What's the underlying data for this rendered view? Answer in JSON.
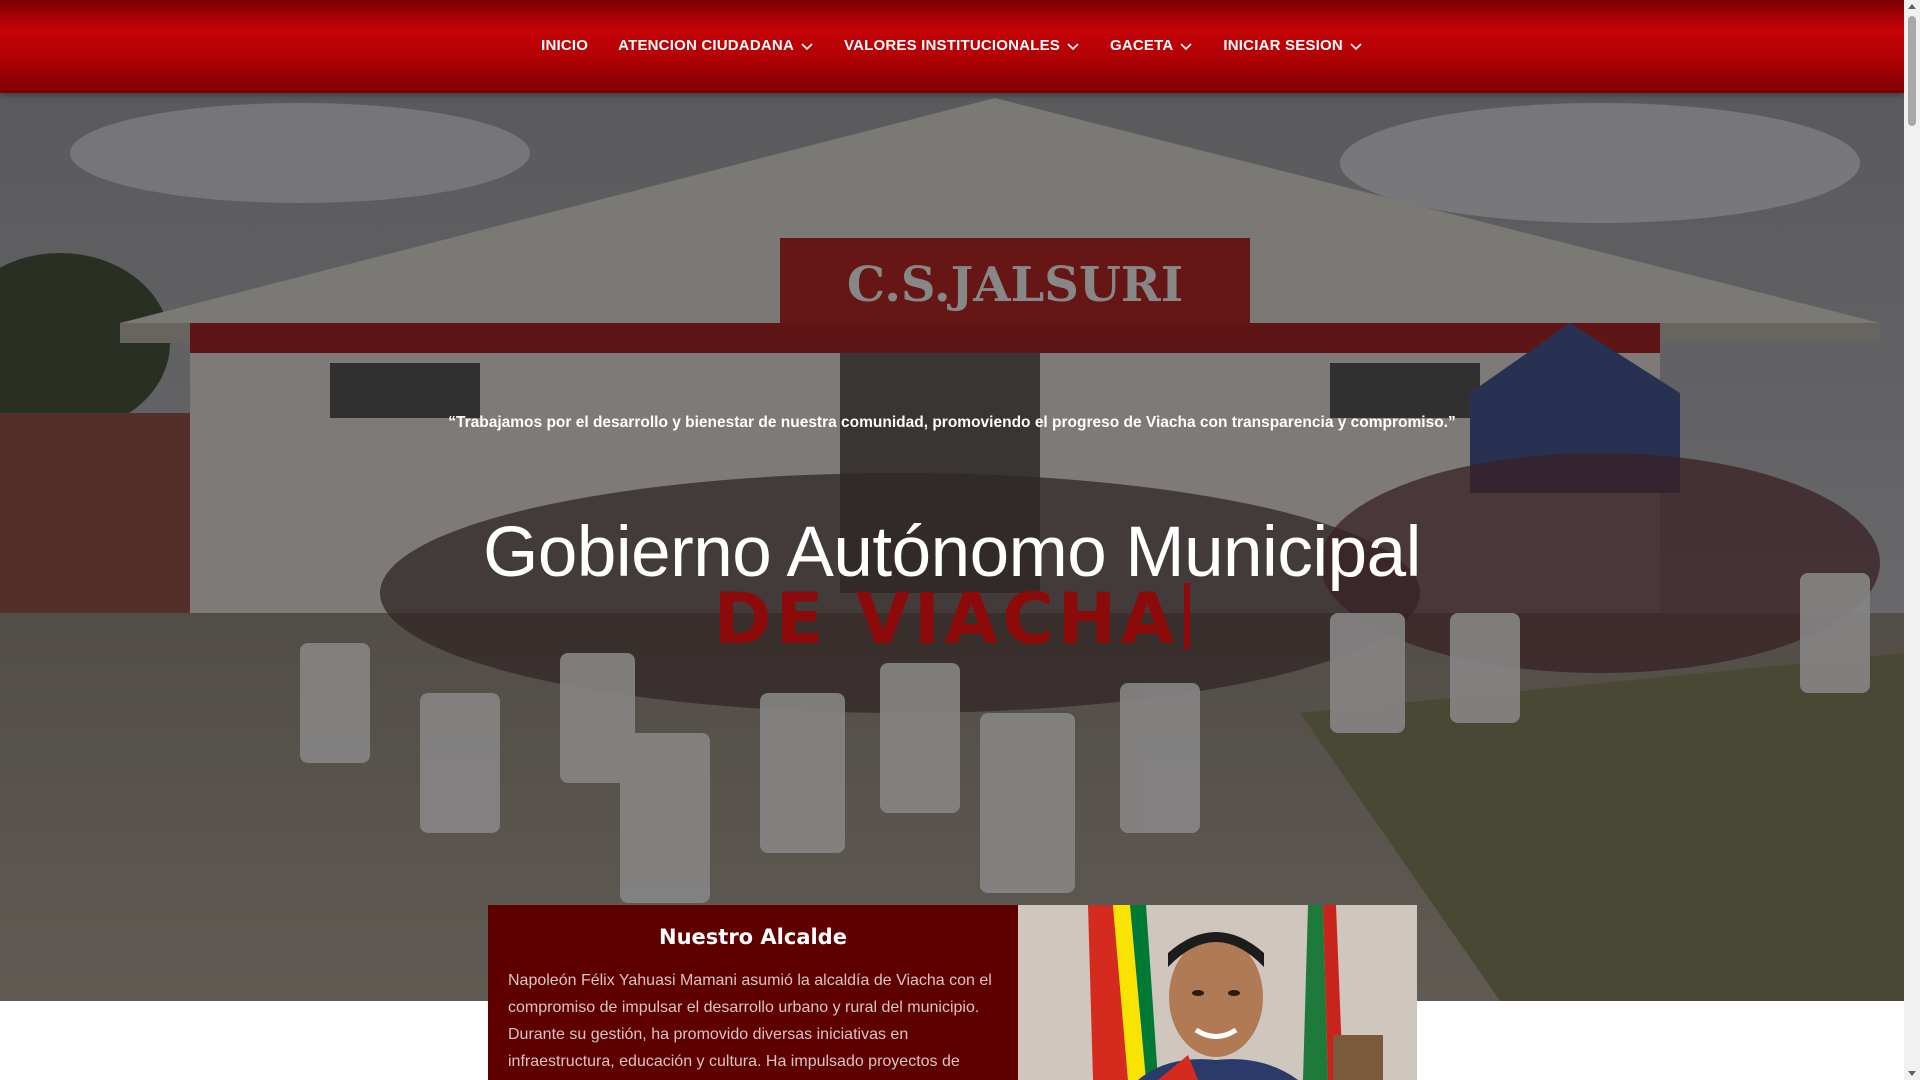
{
  "nav": {
    "items": [
      {
        "label": "INICIO",
        "has_dropdown": false,
        "icon": ""
      },
      {
        "label": "ATENCION CIUDADANA",
        "has_dropdown": true,
        "icon": "chevron-down-icon"
      },
      {
        "label": "VALORES INSTITUCIONALES",
        "has_dropdown": true,
        "icon": "chevron-down-icon"
      },
      {
        "label": "GACETA",
        "has_dropdown": true,
        "icon": "chevron-down-icon"
      },
      {
        "label": "INICIAR SESION",
        "has_dropdown": true,
        "icon": "chevron-down-icon"
      }
    ]
  },
  "hero": {
    "quote": "“Trabajamos por el desarrollo y bienestar de nuestra comunidad, promoviendo el progreso de Viacha con transparencia y compromiso.”",
    "title": "Gobierno Autónomo Municipal",
    "subtitle": "DE VIACHA",
    "building_sign": "C.S.JALSURI"
  },
  "mayor": {
    "heading": "Nuestro Alcalde",
    "text": "Napoleón Félix Yahuasi Mamani asumió la alcaldía de Viacha con el compromiso de impulsar el desarrollo urbano y rural del municipio. Durante su gestión, ha promovido diversas iniciativas en infraestructura, educación y cultura. Ha impulsado proyectos de"
  },
  "colors": {
    "nav_red": "#c50308",
    "subtitle_red": "#8c0a0a",
    "card_bg": "#5e0000"
  }
}
